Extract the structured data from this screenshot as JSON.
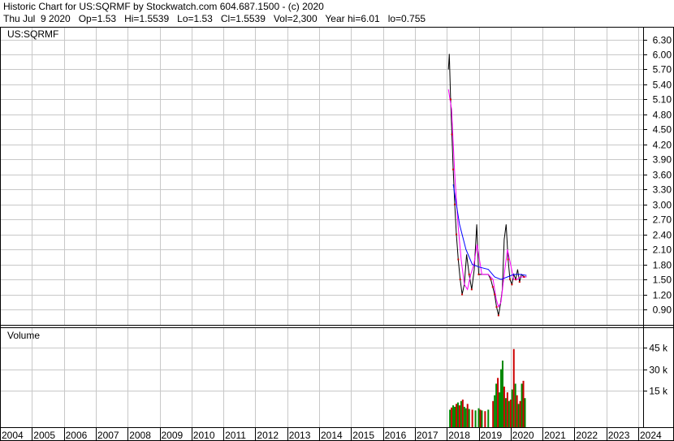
{
  "header": {
    "line1": "Historic Chart for US:SQRMF by Stockwatch.com 604.687.1500 - (c) 2020",
    "line2": "Thu Jul  9 2020   Op=1.53   Hi=1.5539   Lo=1.53   Cl=1.5539   Vol=2,300   Year hi=6.01   lo=0.755"
  },
  "chart_data": [
    {
      "type": "line",
      "title": "US:SQRMF",
      "x_ticks": [
        "2004",
        "2005",
        "2006",
        "2007",
        "2008",
        "2009",
        "2010",
        "2011",
        "2012",
        "2013",
        "2014",
        "2015",
        "2016",
        "2017",
        "2018",
        "2019",
        "2020",
        "2021",
        "2022",
        "2023",
        "2024"
      ],
      "y_ticks": [
        "6.30",
        "6.00",
        "5.70",
        "5.40",
        "5.10",
        "4.80",
        "4.50",
        "4.20",
        "3.90",
        "3.60",
        "3.30",
        "3.00",
        "2.70",
        "2.40",
        "2.10",
        "1.80",
        "1.50",
        "1.20",
        "0.90"
      ],
      "ylim": [
        0.5,
        6.45
      ],
      "grid": true,
      "colors": {
        "price": "#000000",
        "ma_short": "#ff00ff",
        "ma_long": "#0000ff",
        "down": "#cc0000"
      },
      "series": [
        {
          "key": "price",
          "x": [
            2018.05,
            2018.08,
            2018.12,
            2018.16,
            2018.2,
            2018.25,
            2018.3,
            2018.36,
            2018.42,
            2018.48,
            2018.55,
            2018.62,
            2018.7,
            2018.78,
            2018.86,
            2018.94,
            2019.0,
            2019.1,
            2019.2,
            2019.3,
            2019.38,
            2019.44,
            2019.5,
            2019.56,
            2019.62,
            2019.68,
            2019.74,
            2019.8,
            2019.86,
            2019.92,
            2019.98,
            2020.04,
            2020.1,
            2020.16,
            2020.22,
            2020.28,
            2020.34,
            2020.42,
            2020.5
          ],
          "y": [
            5.7,
            6.01,
            5.1,
            4.4,
            3.7,
            3.0,
            2.4,
            1.9,
            1.5,
            1.2,
            1.4,
            2.0,
            1.6,
            1.3,
            1.7,
            2.6,
            1.6,
            1.6,
            1.6,
            1.6,
            1.5,
            1.35,
            1.2,
            0.95,
            0.78,
            1.0,
            1.3,
            2.3,
            2.6,
            1.9,
            1.5,
            1.4,
            1.6,
            1.5,
            1.7,
            1.45,
            1.6,
            1.55,
            1.5539
          ]
        },
        {
          "key": "ma_short",
          "x": [
            2018.05,
            2018.15,
            2018.25,
            2018.35,
            2018.45,
            2018.55,
            2018.65,
            2018.75,
            2018.85,
            2018.95,
            2019.1,
            2019.3,
            2019.45,
            2019.55,
            2019.62,
            2019.7,
            2019.8,
            2019.9,
            2020.0,
            2020.1,
            2020.2,
            2020.3,
            2020.4,
            2020.5
          ],
          "y": [
            5.3,
            4.9,
            3.6,
            2.6,
            1.9,
            1.4,
            1.3,
            1.6,
            1.8,
            2.2,
            1.6,
            1.6,
            1.5,
            1.1,
            0.95,
            1.05,
            1.6,
            2.1,
            1.8,
            1.5,
            1.5,
            1.55,
            1.55,
            1.55
          ]
        },
        {
          "key": "ma_long",
          "x": [
            2018.2,
            2018.4,
            2018.6,
            2018.8,
            2019.0,
            2019.3,
            2019.5,
            2019.7,
            2019.9,
            2020.1,
            2020.3,
            2020.5
          ],
          "y": [
            3.4,
            2.6,
            2.1,
            1.8,
            1.75,
            1.7,
            1.55,
            1.5,
            1.55,
            1.6,
            1.6,
            1.58
          ]
        }
      ]
    },
    {
      "type": "bar",
      "title": "Volume",
      "y_ticks": [
        "45 k",
        "30 k",
        "15 k"
      ],
      "ylim": [
        0,
        55000
      ],
      "grid": true,
      "colors": {
        "up": "#008800",
        "down": "#cc0000"
      },
      "x": [
        2018.1,
        2018.15,
        2018.2,
        2018.25,
        2018.3,
        2018.35,
        2018.4,
        2018.45,
        2018.5,
        2018.55,
        2018.6,
        2018.65,
        2018.7,
        2018.8,
        2018.9,
        2019.0,
        2019.05,
        2019.1,
        2019.2,
        2019.3,
        2019.45,
        2019.5,
        2019.55,
        2019.6,
        2019.65,
        2019.7,
        2019.75,
        2019.8,
        2019.85,
        2019.9,
        2019.95,
        2020.0,
        2020.05,
        2020.1,
        2020.15,
        2020.2,
        2020.25,
        2020.3,
        2020.35,
        2020.4,
        2020.45
      ],
      "values": [
        2000,
        3500,
        5000,
        4000,
        6000,
        7000,
        5000,
        8000,
        9000,
        4000,
        3000,
        6000,
        2500,
        2000,
        1500,
        3000,
        2000,
        1500,
        1000,
        2000,
        8000,
        12000,
        20000,
        24000,
        14000,
        30000,
        36000,
        18000,
        10000,
        14000,
        8000,
        9000,
        16000,
        44000,
        20000,
        12000,
        6000,
        8000,
        20000,
        22000,
        10000
      ],
      "up": [
        1,
        0,
        1,
        1,
        0,
        1,
        0,
        1,
        0,
        1,
        1,
        0,
        1,
        0,
        1,
        1,
        0,
        1,
        0,
        1,
        0,
        1,
        1,
        0,
        1,
        1,
        1,
        0,
        1,
        0,
        1,
        0,
        1,
        0,
        1,
        0,
        1,
        0,
        1,
        0,
        1
      ]
    }
  ]
}
